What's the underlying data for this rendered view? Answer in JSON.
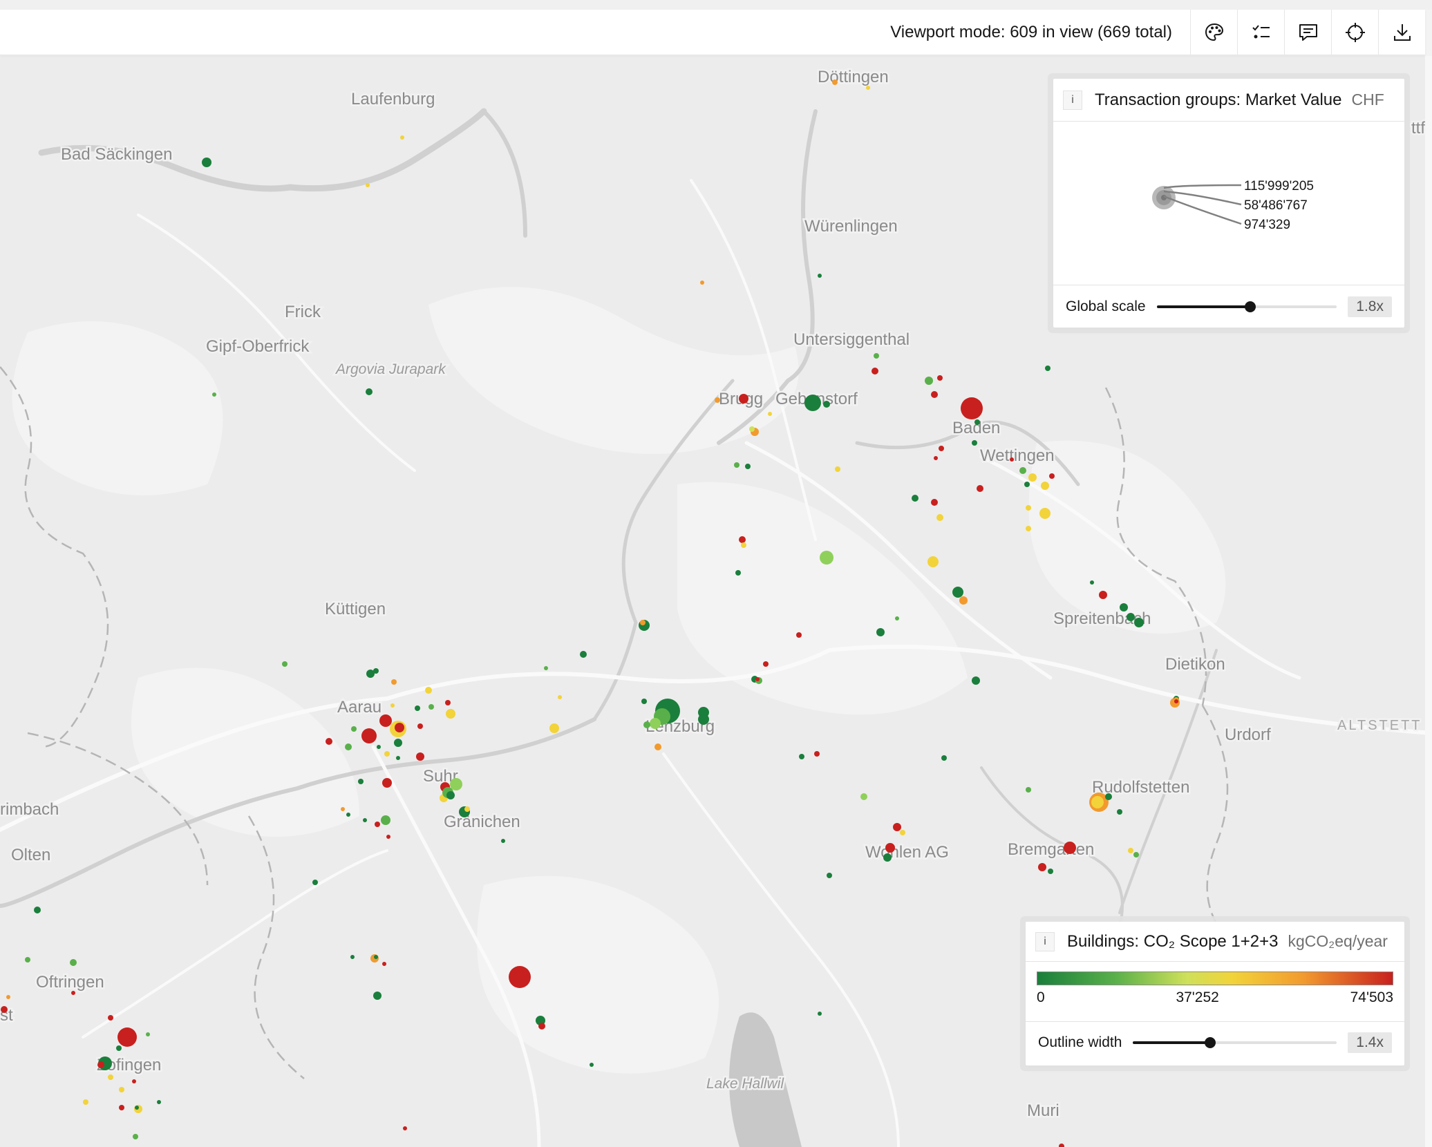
{
  "toolbar": {
    "status_text": "Viewport mode: 609 in view (669 total)",
    "buttons": [
      {
        "name": "palette-icon"
      },
      {
        "name": "legend-list-icon"
      },
      {
        "name": "comment-icon"
      },
      {
        "name": "crosshair-icon"
      },
      {
        "name": "download-icon"
      }
    ]
  },
  "map": {
    "places": [
      "Döttingen",
      "Laufenburg",
      "Bad Säckingen",
      "Würenlingen",
      "Frick",
      "Gipf-Oberfrick",
      "Argovia Jurapark",
      "Untersiggenthal",
      "Brugg",
      "Gebenstorf",
      "Baden",
      "Wettingen",
      "Küttigen",
      "Spreitenbach",
      "Dietikon",
      "Aarau",
      "Lenzburg",
      "Urdorf",
      "ALTSTETT",
      "Suhr",
      "Rudolfstetten",
      "rimbach",
      "Gränichen",
      "Wohlen AG",
      "Bremgarten",
      "Olten",
      "Oftringen",
      "Zofingen",
      "Lake Hallwil",
      "Muri",
      "st",
      "ttf"
    ]
  },
  "transaction_panel": {
    "info": "i",
    "title": "Transaction groups: Market Value",
    "unit": "CHF",
    "size_legend": [
      "115'999'205",
      "58'486'767",
      "974'329"
    ],
    "scale_label": "Global scale",
    "scale_value": "1.8x",
    "scale_fraction": 0.52
  },
  "buildings_panel": {
    "info": "i",
    "title": "Buildings: CO₂ Scope 1+2+3",
    "unit": "kgCO₂eq/year",
    "legend_min": "0",
    "legend_mid": "37'252",
    "legend_max": "74'503",
    "colors": [
      "#1a7f3c",
      "#59b04a",
      "#cfe05a",
      "#f2d33a",
      "#f29a2e",
      "#c8201e"
    ],
    "outline_label": "Outline width",
    "outline_value": "1.4x",
    "outline_fraction": 0.38
  }
}
